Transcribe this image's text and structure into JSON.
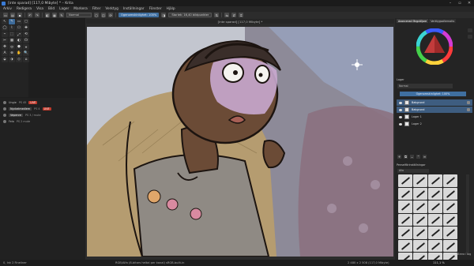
{
  "titlebar": {
    "title": "[inte sparad] [117,0 Mibyte] * – Krita",
    "controls": [
      "minimize-icon",
      "maximize-icon",
      "close-icon"
    ]
  },
  "menu": [
    "Arkiv",
    "Redigera",
    "Visa",
    "Bild",
    "Lager",
    "Markera",
    "Filter",
    "Verktyg",
    "Inställningar",
    "Fönster",
    "Hjälp"
  ],
  "toolbar": {
    "preset": "Normal",
    "opacity": "Ogenomskinlighet: 100%",
    "size": "Storlek: 16,40 bildpunkter"
  },
  "tools": [
    "↖",
    "✎",
    "▭",
    "▢",
    "◯",
    "⌇",
    "⬠",
    "✚",
    "⌁",
    "⬚",
    "⤢",
    "⟲",
    "✂",
    "▦",
    "◐",
    "☊",
    "✥",
    "⬭",
    "⬣",
    "⌖",
    "A",
    "⊕",
    "✋",
    "🔍",
    "⬙",
    "⬗",
    "◇",
    "⌂"
  ],
  "left_dock": {
    "rows": [
      {
        "icon": "paint-icon",
        "name": "Ungie",
        "mid": "PS 45",
        "badge": "LIVE",
        "highlight": false
      },
      {
        "icon": "eye-icon",
        "name": "Nyckelmedlem",
        "mid": "PS 4",
        "badge": "LIVE",
        "highlight": true
      },
      {
        "icon": "mic-icon",
        "name": "Vepenre",
        "mid": "PS 3 / mute",
        "badge": "",
        "highlight": true
      },
      {
        "icon": "user-icon",
        "name": "Fela",
        "mid": "PS 2 mute",
        "badge": "",
        "highlight": false
      }
    ]
  },
  "canvas": {
    "tab_title": "[inte sparad] [117,0 Mibyte] *"
  },
  "right_dock": {
    "tabs": [
      "Avancerad färgväljare",
      "Verktygsalternativ"
    ],
    "layers_title": "Lager",
    "blend_mode": "Normal",
    "opacity": "Ogenomskinlighet: 100%",
    "layers": [
      {
        "name": "Bakgrund",
        "selected": true
      },
      {
        "name": "Bakgrund",
        "selected": true
      },
      {
        "name": "Lager 1",
        "selected": false
      },
      {
        "name": "Lager 2",
        "selected": false
      }
    ],
    "brush_title": "Penselförinställningar",
    "brush_tag": "Alla",
    "brush_count": 28,
    "filter_label": "Filtrera i tag"
  },
  "status": {
    "left": "0, Ink 2 Fineliner",
    "mid": "RGB/Alfa (8-bitars heltal per kanal) sRGB-built-in",
    "right": "2 480 x 2 508 (117,0 Mibyte)",
    "zoom": "111,1 %"
  },
  "colors": {
    "accent": "#3f6fa0",
    "live": "#c0392b"
  }
}
